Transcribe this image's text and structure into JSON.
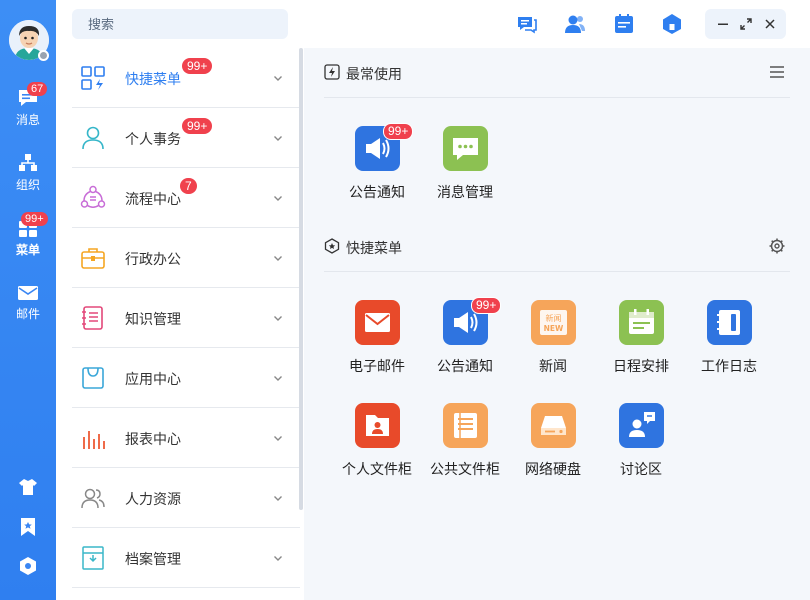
{
  "rail": {
    "items": [
      {
        "label": "消息",
        "badge": "67"
      },
      {
        "label": "组织",
        "badge": ""
      },
      {
        "label": "菜单",
        "badge": "99+"
      },
      {
        "label": "邮件",
        "badge": ""
      }
    ]
  },
  "search": {
    "placeholder": "搜索"
  },
  "menu": {
    "items": [
      {
        "label": "快捷菜单",
        "badge": "99+",
        "icon": "grid-shortcut-icon"
      },
      {
        "label": "个人事务",
        "badge": "99+",
        "icon": "person-icon"
      },
      {
        "label": "流程中心",
        "badge": "7",
        "icon": "workflow-icon"
      },
      {
        "label": "行政办公",
        "badge": "",
        "icon": "briefcase-icon"
      },
      {
        "label": "知识管理",
        "badge": "",
        "icon": "knowledge-book-icon"
      },
      {
        "label": "应用中心",
        "badge": "",
        "icon": "bag-icon"
      },
      {
        "label": "报表中心",
        "badge": "",
        "icon": "bar-chart-icon"
      },
      {
        "label": "人力资源",
        "badge": "",
        "icon": "people-icon"
      },
      {
        "label": "档案管理",
        "badge": "",
        "icon": "archive-icon"
      }
    ]
  },
  "content": {
    "frequent": {
      "title": "最常使用",
      "tiles": [
        {
          "label": "公告通知",
          "badge": "99+",
          "color": "#2f74e0",
          "icon": "megaphone-icon"
        },
        {
          "label": "消息管理",
          "badge": "",
          "color": "#8cc152",
          "icon": "chat-bubble-icon"
        }
      ]
    },
    "shortcuts": {
      "title": "快捷菜单",
      "tiles": [
        {
          "label": "电子邮件",
          "badge": "",
          "color": "#e84a2a",
          "icon": "envelope-icon"
        },
        {
          "label": "公告通知",
          "badge": "99+",
          "color": "#2f74e0",
          "icon": "megaphone-icon"
        },
        {
          "label": "新闻",
          "badge": "",
          "color": "#f6a55a",
          "icon": "news-icon",
          "icon_text": "新闻 NEW"
        },
        {
          "label": "日程安排",
          "badge": "",
          "color": "#8cc152",
          "icon": "calendar-icon"
        },
        {
          "label": "工作日志",
          "badge": "",
          "color": "#2f74e0",
          "icon": "notebook-icon"
        },
        {
          "label": "个人文件柜",
          "badge": "",
          "color": "#e84a2a",
          "icon": "personal-folder-icon"
        },
        {
          "label": "公共文件柜",
          "badge": "",
          "color": "#f6a55a",
          "icon": "public-files-icon"
        },
        {
          "label": "网络硬盘",
          "badge": "",
          "color": "#f6a55a",
          "icon": "hard-disk-icon"
        },
        {
          "label": "讨论区",
          "badge": "",
          "color": "#2f74e0",
          "icon": "discussion-icon"
        }
      ]
    }
  }
}
